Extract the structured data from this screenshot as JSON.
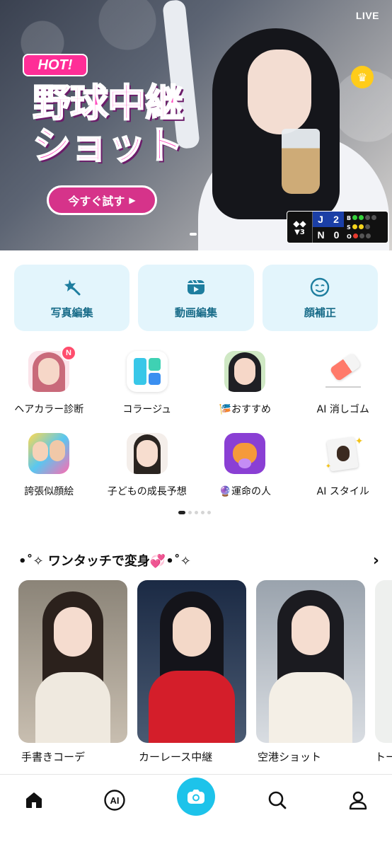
{
  "hero": {
    "live_label": "LIVE",
    "hot_label": "HOT!",
    "title_line1": "野球中継",
    "title_line2": "ショット",
    "cta_label": "今すぐ試す",
    "scoreboard": {
      "inning": "3",
      "team1": "J",
      "team1_score": "2",
      "team2": "N",
      "team2_score": "0",
      "b_label": "B",
      "s_label": "S",
      "o_label": "O"
    }
  },
  "quick_actions": [
    {
      "label": "写真編集",
      "icon": "magic-wand-icon"
    },
    {
      "label": "動画編集",
      "icon": "video-play-icon"
    },
    {
      "label": "顔補正",
      "icon": "face-icon"
    }
  ],
  "features": [
    {
      "label": "ヘアカラー診断",
      "badge": "N"
    },
    {
      "label": "コラージュ"
    },
    {
      "label": "🎏おすすめ"
    },
    {
      "label": "AI 消しゴム"
    },
    {
      "label": "誇張似顔絵"
    },
    {
      "label": "子どもの成長予想"
    },
    {
      "label": "🔮運命の人"
    },
    {
      "label": "AI スタイル"
    }
  ],
  "section": {
    "title": "•˚✧ ワンタッチで変身💞•˚✧",
    "cards": [
      {
        "label": "手書きコーデ"
      },
      {
        "label": "カーレース中継"
      },
      {
        "label": "空港ショット"
      },
      {
        "label": "トー"
      }
    ]
  },
  "colors": {
    "accent": "#1dc3ea",
    "quick_action_bg": "#e3f5fc",
    "quick_action_text": "#176b88",
    "hot_pink": "#ff2e97"
  }
}
